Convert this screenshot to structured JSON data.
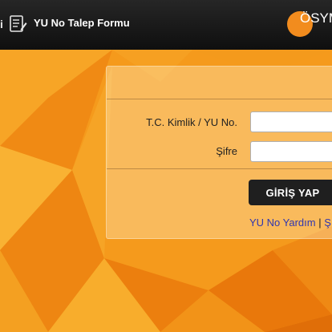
{
  "topbar": {
    "left_fragment": "i",
    "form_link_label": "YU No Talep Formu",
    "logo_text": "ÖSYM"
  },
  "login": {
    "tc_label": "T.C. Kimlik / YU No.",
    "tc_value": "",
    "password_label": "Şifre",
    "password_value": "",
    "submit_label": "GİRİŞ YAP",
    "help_link": "YU No Yardım",
    "separator": "|",
    "second_link_fragment": "Ş"
  },
  "colors": {
    "topbar_bg": "#1a1a1a",
    "background_orange": "#f59a1c",
    "button_bg": "#1f1f1f",
    "link_color": "#2f36b0",
    "logo_orange": "#f28c1e"
  }
}
